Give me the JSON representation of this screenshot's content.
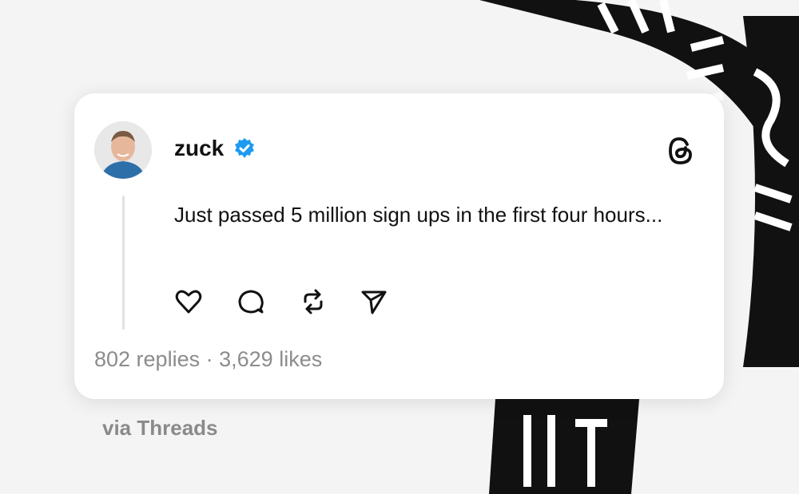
{
  "post": {
    "username": "zuck",
    "verified_icon": "verified-badge-icon",
    "text": "Just passed 5 million sign ups in the first four hours...",
    "replies_count": "802 replies",
    "separator": "·",
    "likes_count": "3,629 likes",
    "actions": [
      "heart-icon",
      "comment-icon",
      "repost-icon",
      "share-icon"
    ],
    "brand_icon": "threads-logo-icon"
  },
  "caption": "via Threads",
  "background": {
    "lettering": [
      "THREADS"
    ]
  },
  "colors": {
    "verified_blue": "#1d9bf0",
    "text": "#111111",
    "muted": "#8c8c8c"
  }
}
